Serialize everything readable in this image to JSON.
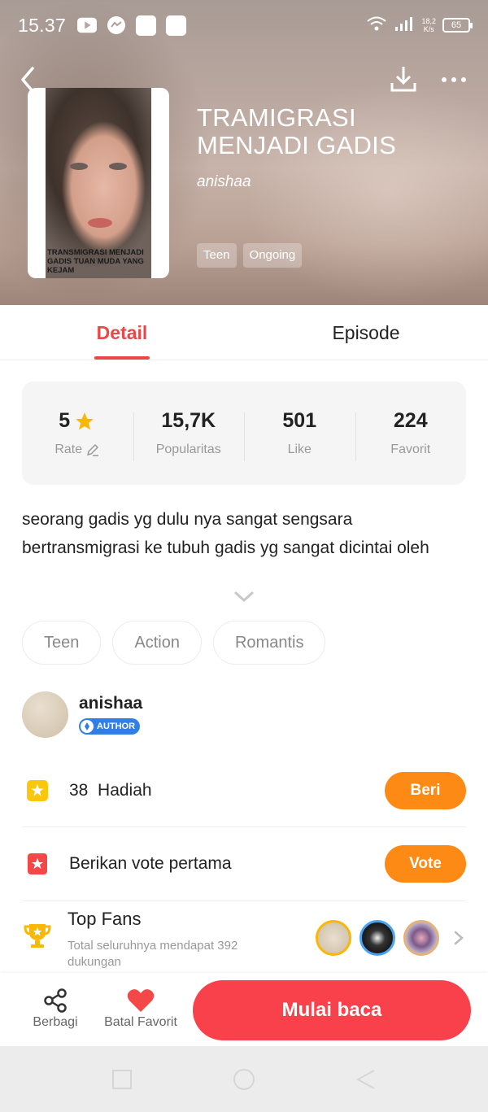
{
  "status_bar": {
    "time": "15.37",
    "speed_top": "18,2",
    "speed_unit": "K/s",
    "battery": "65"
  },
  "book": {
    "title": "TRAMIGRASI MENJADI GADIS",
    "author": "anishaa",
    "cover_text": "TRANSMIGRASI MENJADI GADIS TUAN MUDA YANG KEJAM",
    "tags": [
      "Teen",
      "Ongoing"
    ]
  },
  "tabs": [
    {
      "label": "Detail",
      "active": true
    },
    {
      "label": "Episode",
      "active": false
    }
  ],
  "stats": [
    {
      "value": "5",
      "label": "Rate"
    },
    {
      "value": "15,7K",
      "label": "Popularitas"
    },
    {
      "value": "501",
      "label": "Like"
    },
    {
      "value": "224",
      "label": "Favorit"
    }
  ],
  "synopsis": "seorang gadis yg dulu nya sangat sengsara bertransmigrasi ke tubuh gadis yg sangat dicintai oleh",
  "genres": [
    "Teen",
    "Action",
    "Romantis"
  ],
  "author_card": {
    "name": "anishaa",
    "badge": "AUTHOR"
  },
  "gift_row": {
    "count": "38",
    "label": "Hadiah",
    "button": "Beri"
  },
  "vote_row": {
    "label": "Berikan vote pertama",
    "button": "Vote"
  },
  "top_fans": {
    "title": "Top Fans",
    "subtitle": "Total seluruhnya mendapat 392 dukungan"
  },
  "bottom_bar": {
    "share": "Berbagi",
    "favorite": "Batal Favorit",
    "read": "Mulai baca"
  },
  "colors": {
    "accent_red": "#e84848",
    "button_orange": "#fd8a14",
    "read_red": "#f9414b",
    "author_blue": "#2f7fe6"
  }
}
